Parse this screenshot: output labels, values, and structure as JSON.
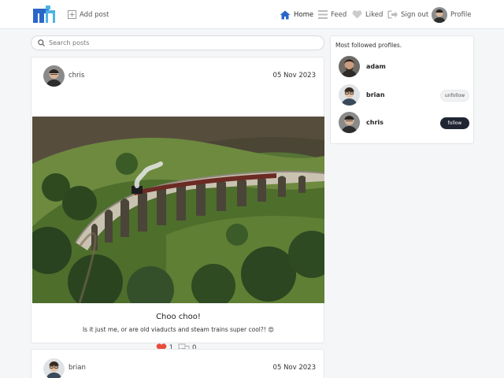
{
  "nav": {
    "add_post": "Add post",
    "home": "Home",
    "feed": "Feed",
    "liked": "Liked",
    "sign_out": "Sign out",
    "profile": "Profile"
  },
  "search": {
    "placeholder": "Search posts"
  },
  "posts": [
    {
      "user": "chris",
      "date": "05 Nov 2023",
      "title": "Choo choo!",
      "body": "Is it just me, or are old viaducts and steam trains super cool?! 😍",
      "likes": "1",
      "comments": "0"
    },
    {
      "user": "brian",
      "date": "05 Nov 2023"
    }
  ],
  "sidebar": {
    "title": "Most followed profiles.",
    "profiles": [
      {
        "name": "adam"
      },
      {
        "name": "brian",
        "action": "unfollow"
      },
      {
        "name": "chris",
        "action": "follow"
      }
    ]
  },
  "colors": {
    "brand_blue": "#2a67c9",
    "like_red": "#e84c3d",
    "follow_dark": "#1f2533"
  }
}
